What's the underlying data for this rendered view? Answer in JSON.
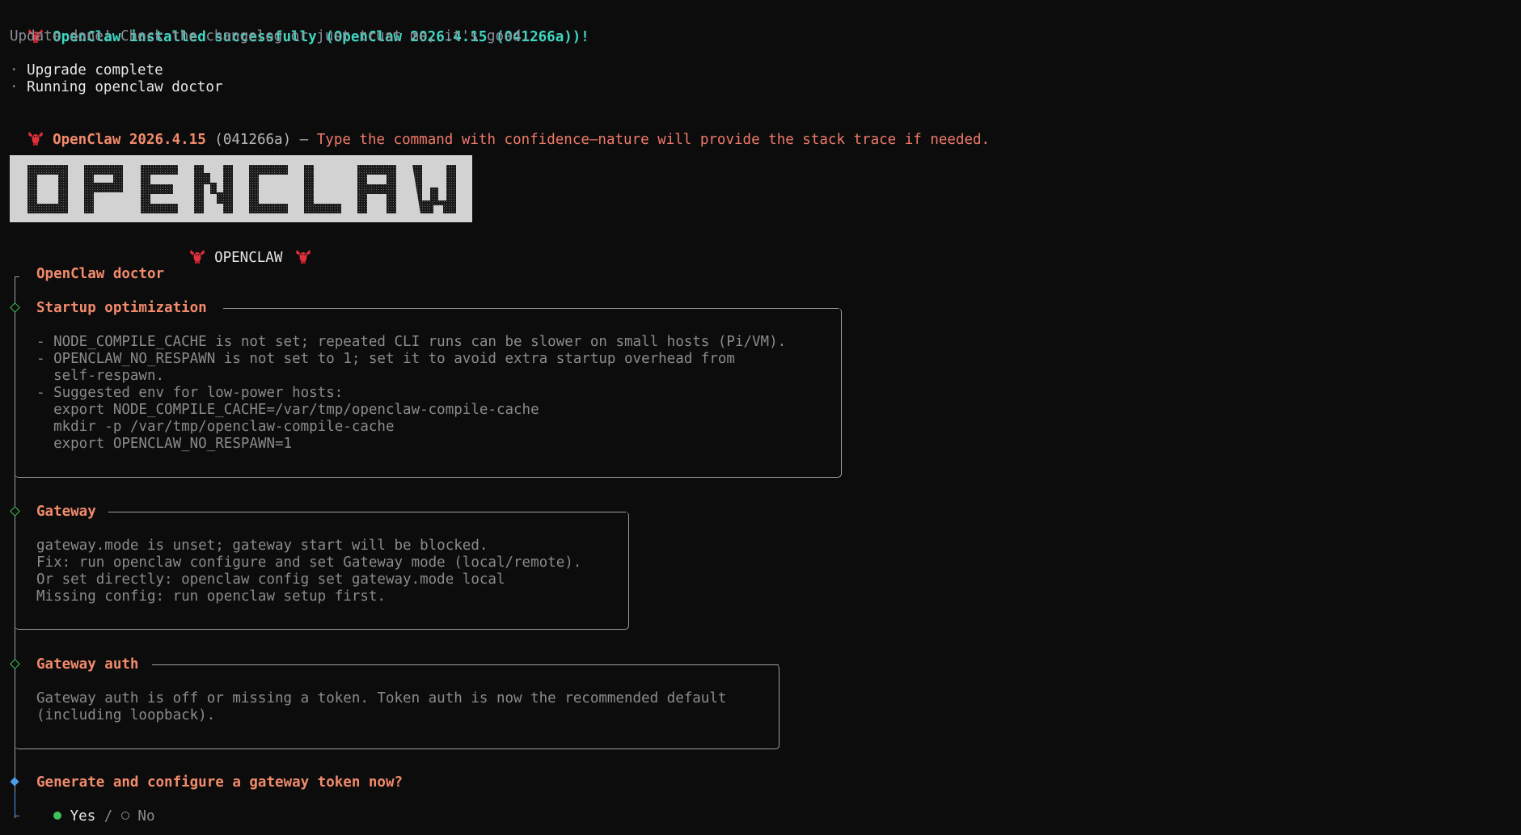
{
  "install": {
    "success_line": "OpenClaw installed successfully (OpenClaw 2026.4.15 (041266a))!",
    "tagline": "Update done! Check the changelog or just trust me, it's good."
  },
  "steps": [
    {
      "bullet": "·",
      "text": "Upgrade complete"
    },
    {
      "bullet": "·",
      "text": "Running openclaw doctor"
    }
  ],
  "version_line": {
    "name": "OpenClaw 2026.4.15",
    "hash": "(041266a)",
    "dash": "—",
    "message": "Type the command with confidence—nature will provide the stack trace if needed."
  },
  "banner": {
    "ascii_word": "OPENCLAW",
    "caption": "OPENCLAW"
  },
  "doctor": {
    "title": "OpenClaw doctor",
    "sections": [
      {
        "title": "Startup optimization",
        "lines": [
          "- NODE_COMPILE_CACHE is not set; repeated CLI runs can be slower on small hosts (Pi/VM).",
          "- OPENCLAW_NO_RESPAWN is not set to 1; set it to avoid extra startup overhead from",
          "  self-respawn.",
          "- Suggested env for low-power hosts:",
          "  export NODE_COMPILE_CACHE=/var/tmp/openclaw-compile-cache",
          "  mkdir -p /var/tmp/openclaw-compile-cache",
          "  export OPENCLAW_NO_RESPAWN=1"
        ]
      },
      {
        "title": "Gateway",
        "lines": [
          "gateway.mode is unset; gateway start will be blocked.",
          "Fix: run openclaw configure and set Gateway mode (local/remote).",
          "Or set directly: openclaw config set gateway.mode local",
          "Missing config: run openclaw setup first."
        ]
      },
      {
        "title": "Gateway auth",
        "lines": [
          "Gateway auth is off or missing a token. Token auth is now the recommended default",
          "(including loopback)."
        ]
      }
    ],
    "prompt": {
      "question": "Generate and configure a gateway token now?",
      "yes": "Yes",
      "separator": "/",
      "no": "No",
      "selected": "Yes"
    }
  },
  "colors": {
    "background": "#0c0c0c",
    "cyan": "#3fd7c2",
    "orange": "#f28b6c",
    "green": "#3ec15b",
    "blue": "#4b9be6",
    "lobster": "#e0303a"
  },
  "icons": [
    "lobster-icon",
    "diamond-icon",
    "radio-selected-icon",
    "radio-unselected-icon"
  ]
}
